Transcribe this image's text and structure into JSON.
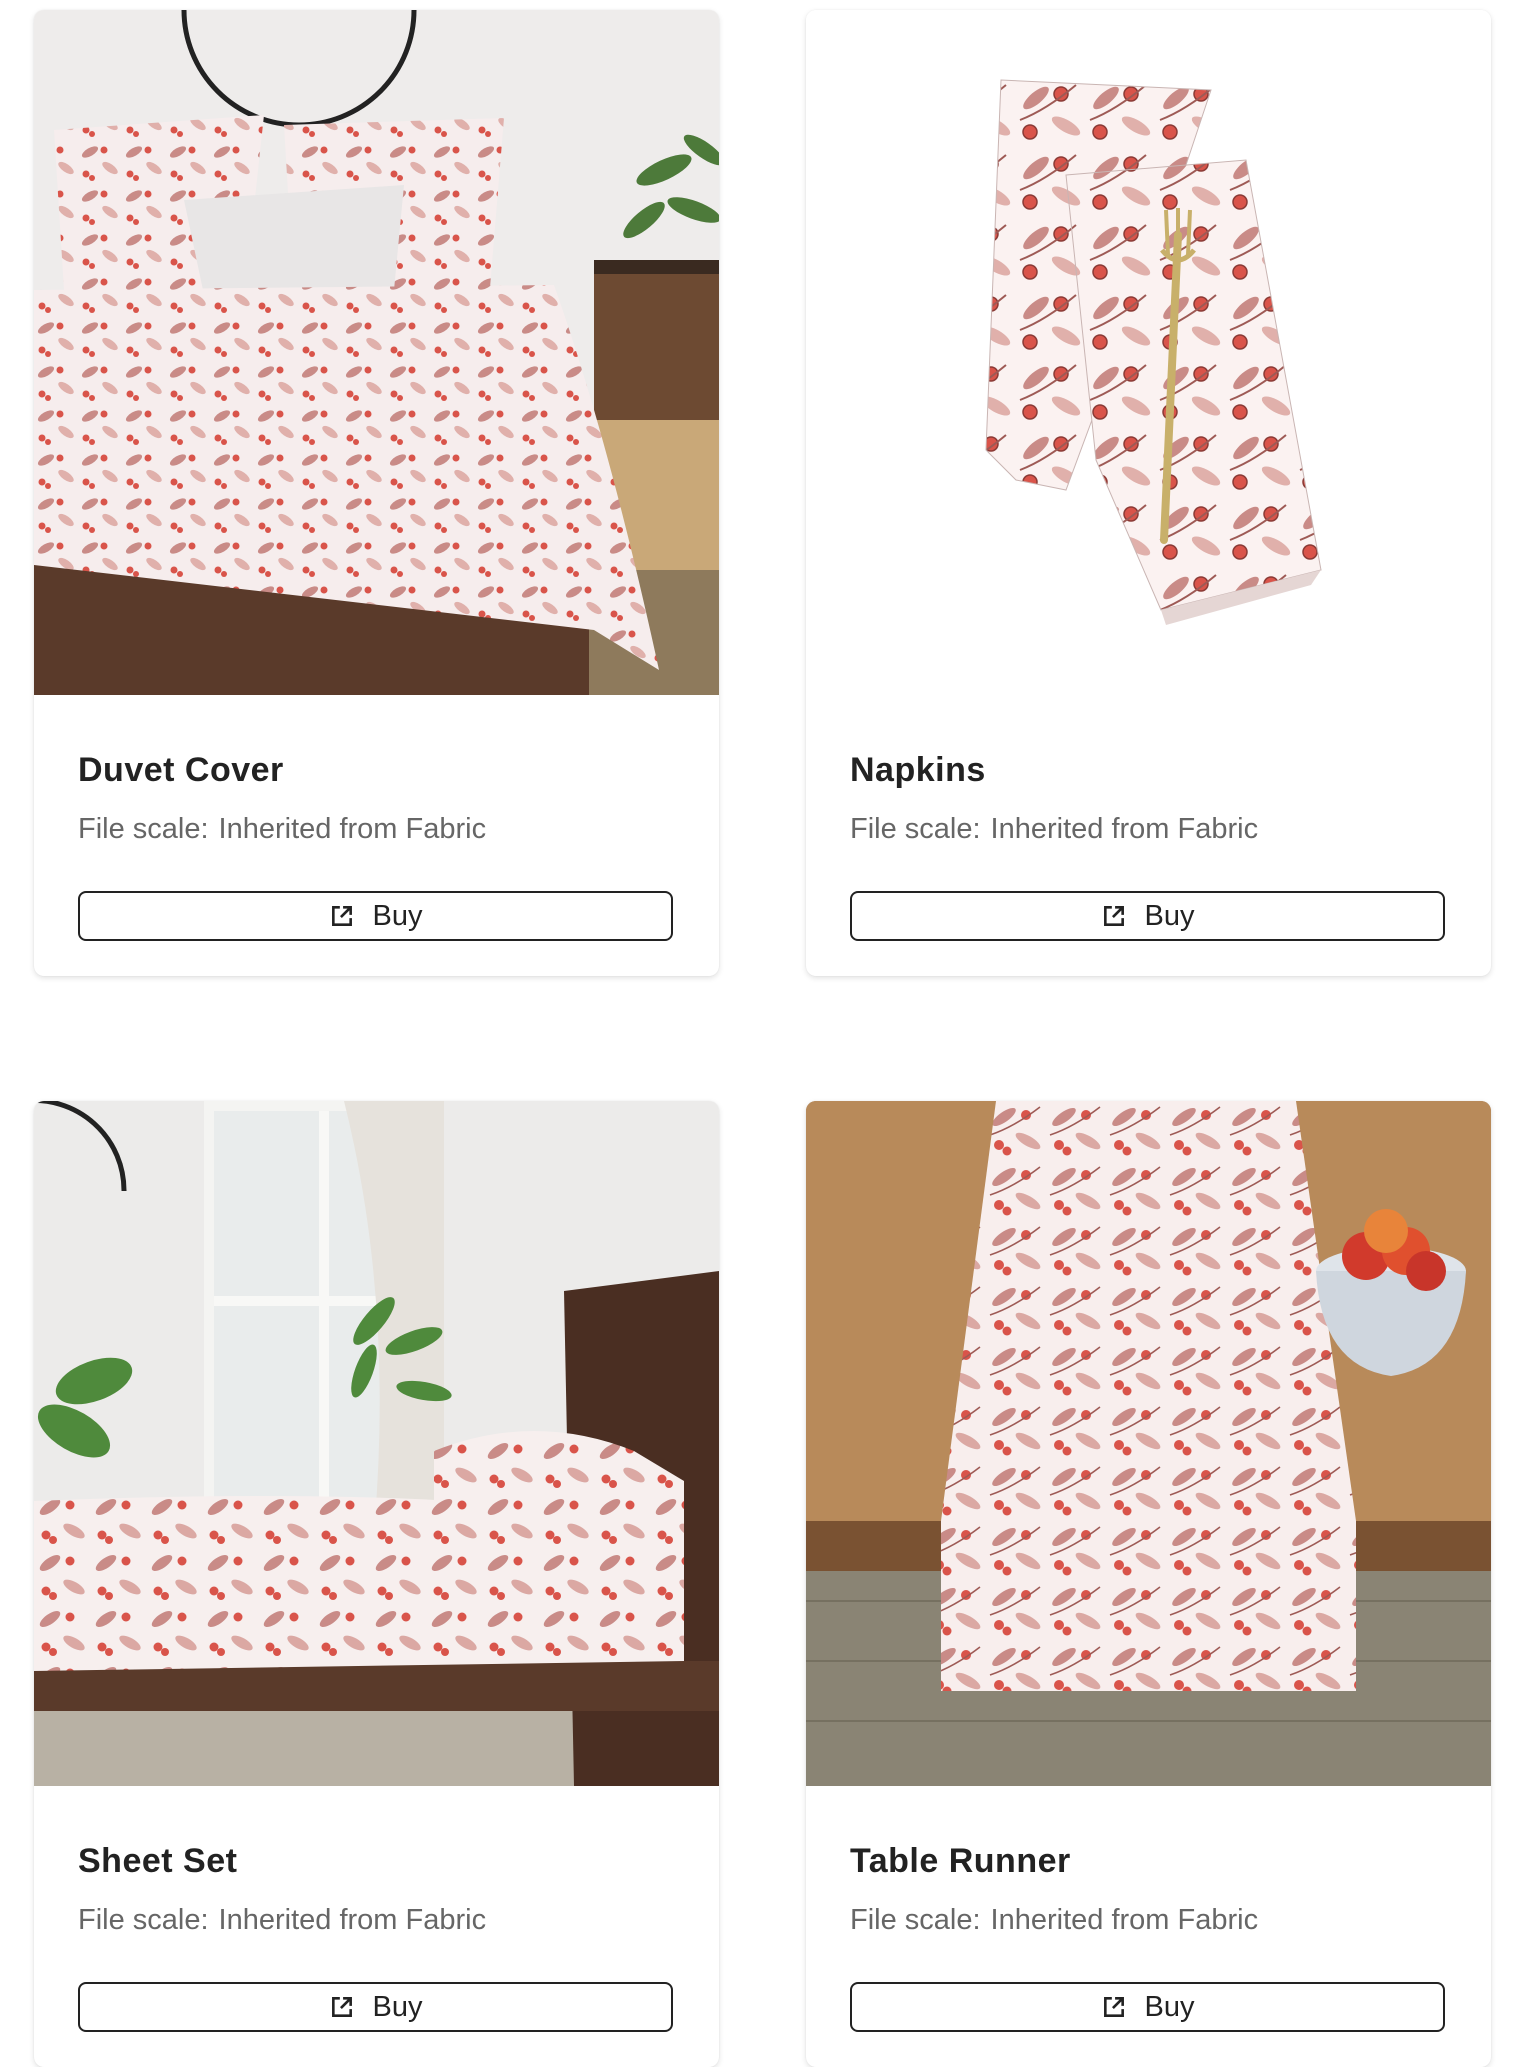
{
  "products": [
    {
      "name": "Duvet Cover",
      "scale_label": "File scale:",
      "scale_value": "Inherited from Fabric",
      "button_label": "Buy",
      "button_icon": "external-link-icon"
    },
    {
      "name": "Napkins",
      "scale_label": "File scale:",
      "scale_value": "Inherited from Fabric",
      "button_label": "Buy",
      "button_icon": "external-link-icon"
    },
    {
      "name": "Sheet Set",
      "scale_label": "File scale:",
      "scale_value": "Inherited from Fabric",
      "button_label": "Buy",
      "button_icon": "external-link-icon"
    },
    {
      "name": "Table Runner",
      "scale_label": "File scale:",
      "scale_value": "Inherited from Fabric",
      "button_label": "Buy",
      "button_icon": "external-link-icon"
    }
  ],
  "colors": {
    "berry": "#d9544a",
    "leaf": "#c98b87",
    "leaf_light": "#e8c3bf",
    "wood_dark": "#5a3a2a",
    "wood_floor": "#9a7a55"
  }
}
